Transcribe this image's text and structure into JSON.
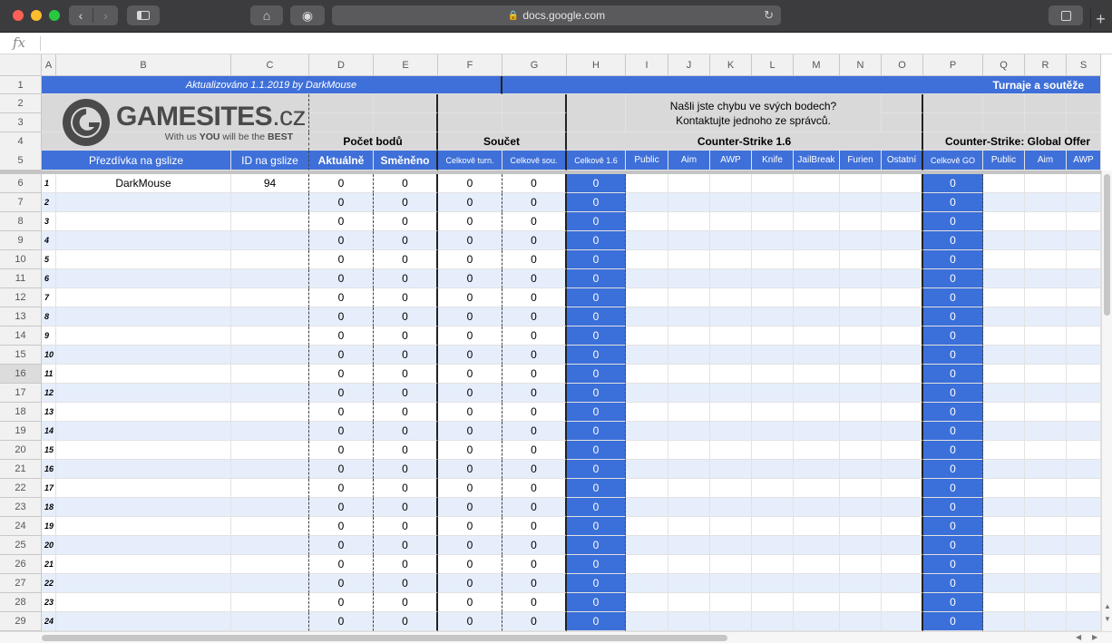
{
  "browser": {
    "url": "docs.google.com",
    "icons": [
      "back-icon",
      "forward-icon",
      "sidebar-icon",
      "home-icon",
      "shield-icon",
      "lock-icon",
      "reload-icon",
      "tabs-icon",
      "new-tab-icon"
    ]
  },
  "formula_bar": {
    "label": "fx",
    "value": ""
  },
  "columns": [
    "A",
    "B",
    "C",
    "D",
    "E",
    "F",
    "G",
    "H",
    "I",
    "J",
    "K",
    "L",
    "M",
    "N",
    "O",
    "P",
    "Q",
    "R",
    "S"
  ],
  "rows_visible": [
    "1",
    "2",
    "3",
    "4",
    "5",
    "6",
    "7",
    "8",
    "9",
    "10",
    "11",
    "12",
    "13",
    "14",
    "15",
    "16",
    "17",
    "18",
    "19",
    "20",
    "21",
    "22",
    "23",
    "24",
    "25",
    "26",
    "27",
    "28",
    "29"
  ],
  "selected_row": "16",
  "header": {
    "updated": "Aktualizováno 1.1.2019 by DarkMouse",
    "tournaments": "Turnaje a soutěže",
    "contact": "Našli jste chybu ve svých bodech? Kontaktujte jednoho ze správců.",
    "logo": {
      "brand": "GAMESITES.cz",
      "brand_main": "GAMESITES",
      "brand_tld": ".cz",
      "tagline_pre": "With us ",
      "tagline_you": "YOU",
      "tagline_mid": " will be the ",
      "tagline_best": "BEST"
    },
    "group_points": "Počet bodů",
    "group_sum": "Součet",
    "group_cs16": "Counter-Strike 1.6",
    "group_csgo": "Counter-Strike: Global Offer"
  },
  "subheaders": {
    "nick": "Přezdívka na gslize",
    "id": "ID na gslize",
    "current": "Aktuálně",
    "exchanged": "Směněno",
    "total_tourn": "Celkově turn.",
    "total_comp": "Celkově sou.",
    "cs16_total": "Celkově 1.6",
    "public": "Public",
    "aim": "Aim",
    "awp": "AWP",
    "knife": "Knife",
    "jailbreak": "JailBreak",
    "furien": "Furien",
    "other": "Ostatní",
    "go_total": "Celkově GO",
    "go_public": "Public",
    "go_aim": "Aim",
    "go_awp": "AWP"
  },
  "data_rows": [
    {
      "n": "1",
      "nick": "DarkMouse",
      "id": "94",
      "d": "0",
      "e": "0",
      "f": "0",
      "g": "0",
      "h": "0",
      "p": "0"
    },
    {
      "n": "2",
      "nick": "",
      "id": "",
      "d": "0",
      "e": "0",
      "f": "0",
      "g": "0",
      "h": "0",
      "p": "0"
    },
    {
      "n": "3",
      "nick": "",
      "id": "",
      "d": "0",
      "e": "0",
      "f": "0",
      "g": "0",
      "h": "0",
      "p": "0"
    },
    {
      "n": "4",
      "nick": "",
      "id": "",
      "d": "0",
      "e": "0",
      "f": "0",
      "g": "0",
      "h": "0",
      "p": "0"
    },
    {
      "n": "5",
      "nick": "",
      "id": "",
      "d": "0",
      "e": "0",
      "f": "0",
      "g": "0",
      "h": "0",
      "p": "0"
    },
    {
      "n": "6",
      "nick": "",
      "id": "",
      "d": "0",
      "e": "0",
      "f": "0",
      "g": "0",
      "h": "0",
      "p": "0"
    },
    {
      "n": "7",
      "nick": "",
      "id": "",
      "d": "0",
      "e": "0",
      "f": "0",
      "g": "0",
      "h": "0",
      "p": "0"
    },
    {
      "n": "8",
      "nick": "",
      "id": "",
      "d": "0",
      "e": "0",
      "f": "0",
      "g": "0",
      "h": "0",
      "p": "0"
    },
    {
      "n": "9",
      "nick": "",
      "id": "",
      "d": "0",
      "e": "0",
      "f": "0",
      "g": "0",
      "h": "0",
      "p": "0"
    },
    {
      "n": "10",
      "nick": "",
      "id": "",
      "d": "0",
      "e": "0",
      "f": "0",
      "g": "0",
      "h": "0",
      "p": "0"
    },
    {
      "n": "11",
      "nick": "",
      "id": "",
      "d": "0",
      "e": "0",
      "f": "0",
      "g": "0",
      "h": "0",
      "p": "0"
    },
    {
      "n": "12",
      "nick": "",
      "id": "",
      "d": "0",
      "e": "0",
      "f": "0",
      "g": "0",
      "h": "0",
      "p": "0"
    },
    {
      "n": "13",
      "nick": "",
      "id": "",
      "d": "0",
      "e": "0",
      "f": "0",
      "g": "0",
      "h": "0",
      "p": "0"
    },
    {
      "n": "14",
      "nick": "",
      "id": "",
      "d": "0",
      "e": "0",
      "f": "0",
      "g": "0",
      "h": "0",
      "p": "0"
    },
    {
      "n": "15",
      "nick": "",
      "id": "",
      "d": "0",
      "e": "0",
      "f": "0",
      "g": "0",
      "h": "0",
      "p": "0"
    },
    {
      "n": "16",
      "nick": "",
      "id": "",
      "d": "0",
      "e": "0",
      "f": "0",
      "g": "0",
      "h": "0",
      "p": "0"
    },
    {
      "n": "17",
      "nick": "",
      "id": "",
      "d": "0",
      "e": "0",
      "f": "0",
      "g": "0",
      "h": "0",
      "p": "0"
    },
    {
      "n": "18",
      "nick": "",
      "id": "",
      "d": "0",
      "e": "0",
      "f": "0",
      "g": "0",
      "h": "0",
      "p": "0"
    },
    {
      "n": "19",
      "nick": "",
      "id": "",
      "d": "0",
      "e": "0",
      "f": "0",
      "g": "0",
      "h": "0",
      "p": "0"
    },
    {
      "n": "20",
      "nick": "",
      "id": "",
      "d": "0",
      "e": "0",
      "f": "0",
      "g": "0",
      "h": "0",
      "p": "0"
    },
    {
      "n": "21",
      "nick": "",
      "id": "",
      "d": "0",
      "e": "0",
      "f": "0",
      "g": "0",
      "h": "0",
      "p": "0"
    },
    {
      "n": "22",
      "nick": "",
      "id": "",
      "d": "0",
      "e": "0",
      "f": "0",
      "g": "0",
      "h": "0",
      "p": "0"
    },
    {
      "n": "23",
      "nick": "",
      "id": "",
      "d": "0",
      "e": "0",
      "f": "0",
      "g": "0",
      "h": "0",
      "p": "0"
    },
    {
      "n": "24",
      "nick": "",
      "id": "",
      "d": "0",
      "e": "0",
      "f": "0",
      "g": "0",
      "h": "0",
      "p": "0"
    }
  ],
  "colors": {
    "accent": "#3f70d9",
    "band": "#e6eefc",
    "header_gray": "#d9d9d9"
  }
}
